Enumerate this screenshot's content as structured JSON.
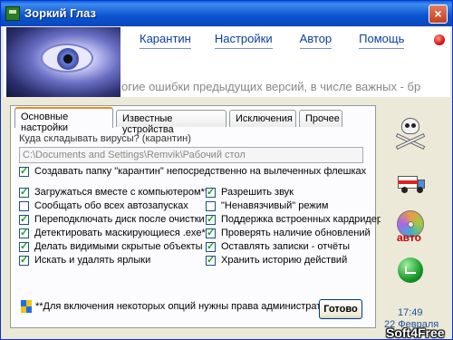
{
  "window": {
    "title": "Зоркий Глаз",
    "close_symbol": "×"
  },
  "nav": {
    "items": [
      "Карантин",
      "Настройки",
      "Автор",
      "Помощь"
    ]
  },
  "marquee_text": "огие ошибки предыдущих версий, в числе важных - бр",
  "tabs": [
    "Основные настройки",
    "Известные устройства",
    "Исключения",
    "Прочее"
  ],
  "quarantine": {
    "label": "Куда складывать вирусы? (карантин)",
    "path_value": "C:\\Documents and Settings\\Remvik\\Рабочий стол",
    "create_folder_label": "Создавать папку \"карантин\" непосредственно на вылеченных флешках"
  },
  "options_left": [
    {
      "label": "Загружаться вместе с компьютером**",
      "checked": true
    },
    {
      "label": "Сообщать обо всех автозапусках",
      "checked": false
    },
    {
      "label": "Переподключать диск после очистки",
      "checked": true
    },
    {
      "label": "Детектировать маскирующиеся .exe**",
      "checked": true
    },
    {
      "label": "Делать видимыми скрытые объекты",
      "checked": true
    },
    {
      "label": "Искать и удалять ярлыки",
      "checked": true
    }
  ],
  "options_right": [
    {
      "label": "Разрешить звук",
      "checked": true
    },
    {
      "label": "\"Ненавязчивый\" режим",
      "checked": false
    },
    {
      "label": "Поддержка встроенных кардридеров",
      "checked": true
    },
    {
      "label": "Проверять наличие обновлений",
      "checked": true
    },
    {
      "label": "Оставлять записки - отчёты",
      "checked": true
    },
    {
      "label": "Хранить историю действий",
      "checked": true
    }
  ],
  "admin_note": "**Для включения некоторых опций нужны права администратора",
  "done_button": "Готово",
  "sidebar": {
    "icons": [
      "skull-icon",
      "ambulance-icon",
      "autorun-cd-icon",
      "update-globe-icon"
    ],
    "cd_label": "авто"
  },
  "clock": {
    "time": "17:49",
    "date": "22 Февраля"
  },
  "watermark": "Soft4Free",
  "colors": {
    "title_bar": "#0a53cf",
    "nav_link": "#0b3ea0",
    "active_tab_accent": "#e68b2c",
    "cd_label": "#cc0000"
  }
}
